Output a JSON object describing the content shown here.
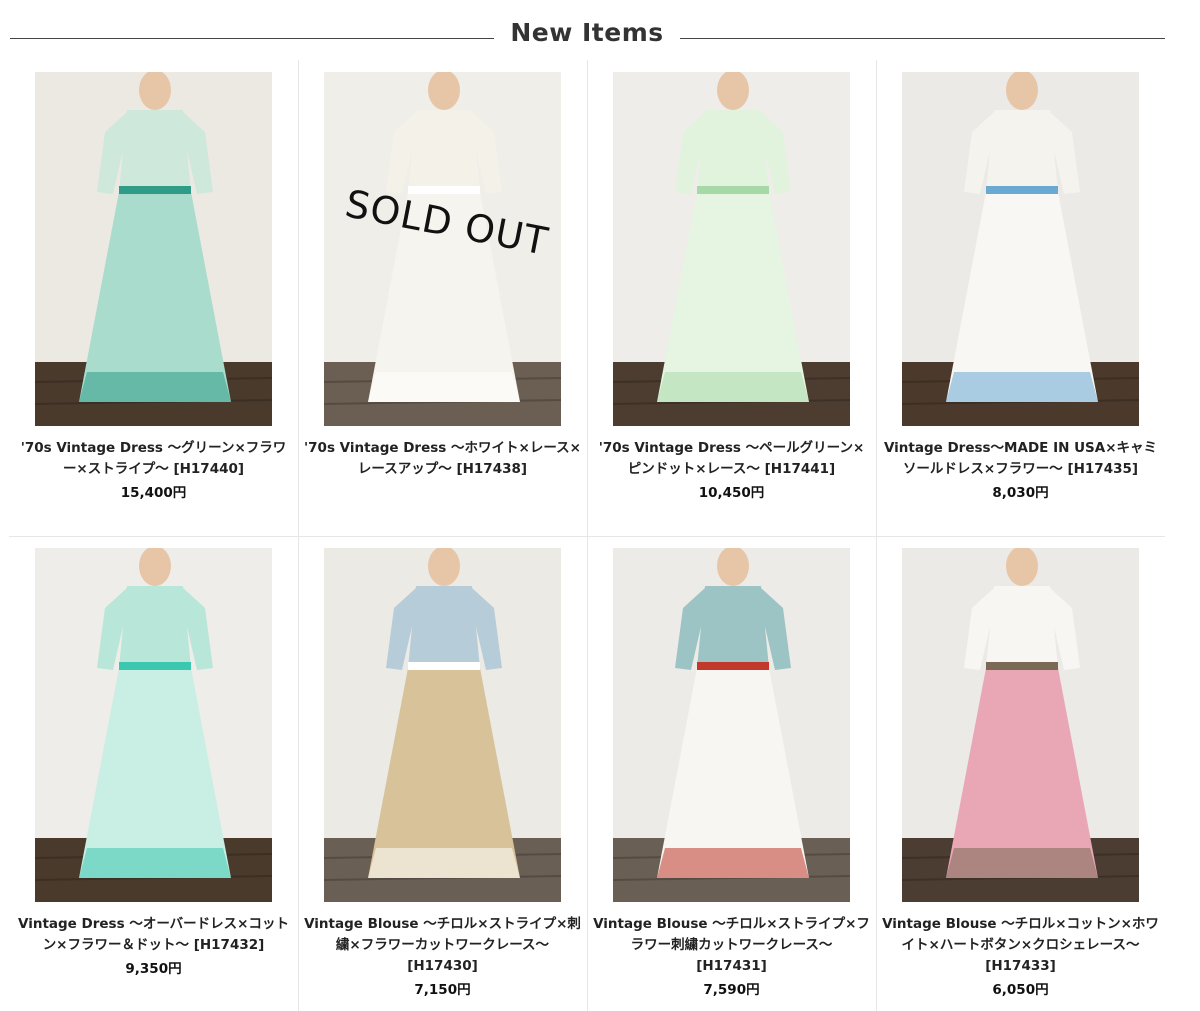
{
  "header": {
    "title": "New Items"
  },
  "products": [
    {
      "name": "'70s Vintage Dress ～グリーン×フラワー×ストライプ～ [H17440]",
      "price": "15,400円",
      "sold_out": "",
      "colors": {
        "bg": "#ece9e3",
        "top": "#cfe8dc",
        "skirt": "#a9dccd",
        "accent": "#2e9c86",
        "floor": "#4a3a2c"
      }
    },
    {
      "name": "'70s Vintage Dress ～ホワイト×レース×レースアップ～ [H17438]",
      "price": "",
      "sold_out": "SOLD OUT",
      "colors": {
        "bg": "#efeee9",
        "top": "#f4f1e8",
        "skirt": "#f6f4ee",
        "accent": "#ffffff",
        "floor": "#6b5e52"
      }
    },
    {
      "name": "'70s Vintage Dress ～ペールグリーン×ピンドット×レース～ [H17441]",
      "price": "10,450円",
      "sold_out": "",
      "colors": {
        "bg": "#eeedea",
        "top": "#e1f2dd",
        "skirt": "#e6f5e2",
        "accent": "#a7d9a8",
        "floor": "#4d3d30"
      }
    },
    {
      "name": "Vintage Dress～MADE IN USA×キャミソールドレス×フラワー～ [H17435]",
      "price": "8,030円",
      "sold_out": "",
      "colors": {
        "bg": "#eceae6",
        "top": "#f5f3ee",
        "skirt": "#f8f7f3",
        "accent": "#6aa9d3",
        "floor": "#4b3a2b"
      }
    },
    {
      "name": "Vintage Dress ～オーバードレス×コットン×フラワー＆ドット～ [H17432]",
      "price": "9,350円",
      "sold_out": "",
      "colors": {
        "bg": "#eeede9",
        "top": "#b8e6d8",
        "skirt": "#c9eee3",
        "accent": "#3cc7b0",
        "floor": "#4a3a2c"
      }
    },
    {
      "name": "Vintage Blouse ～チロル×ストライプ×刺繍×フラワーカットワークレース～ [H17430]",
      "price": "7,150円",
      "sold_out": "",
      "colors": {
        "bg": "#eceae5",
        "top": "#b7ccd9",
        "skirt": "#d8c29a",
        "accent": "#ffffff",
        "floor": "#6a5f55"
      }
    },
    {
      "name": "Vintage Blouse ～チロル×ストライプ×フラワー刺繍カットワークレース～ [H17431]",
      "price": "7,590円",
      "sold_out": "",
      "colors": {
        "bg": "#ecebe7",
        "top": "#9cc4c4",
        "skirt": "#f7f6f2",
        "accent": "#c0392b",
        "floor": "#6a5f55"
      }
    },
    {
      "name": "Vintage Blouse ～チロル×コットン×ホワイト×ハートボタン×クロシェレース～ [H17433]",
      "price": "6,050円",
      "sold_out": "",
      "colors": {
        "bg": "#ebeae6",
        "top": "#f7f6f2",
        "skirt": "#e9a7b5",
        "accent": "#7a6a55",
        "floor": "#4b3d31"
      }
    }
  ]
}
